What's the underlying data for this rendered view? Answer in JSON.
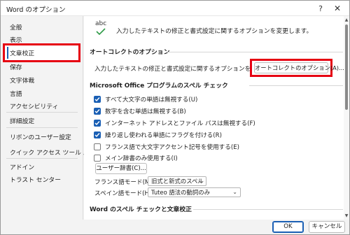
{
  "window": {
    "title": "Word のオプション",
    "help_glyph": "?",
    "close_glyph": "✕"
  },
  "sidebar": {
    "items": [
      {
        "label": "全般"
      },
      {
        "label": "表示"
      },
      {
        "label": "文章校正",
        "selected": true
      },
      {
        "label": "保存"
      },
      {
        "label": "文字体裁"
      },
      {
        "label": "言語"
      },
      {
        "label": "アクセシビリティ"
      },
      {
        "label": "詳細設定"
      },
      {
        "label": "リボンのユーザー設定"
      },
      {
        "label": "クイック アクセス ツール バー"
      },
      {
        "label": "アドイン"
      },
      {
        "label": "トラスト センター"
      }
    ]
  },
  "main": {
    "icon_text": "abc",
    "intro": "入力したテキストの修正と書式設定に関するオプションを変更します。",
    "autocorrect_section": {
      "title": "オートコレクトのオプション",
      "description": "入力したテキストの修正と書式設定に関するオプションを変更します。",
      "button_label": "オートコレクトのオプション(A)..."
    },
    "spell_section": {
      "title": "Microsoft Office プログラムのスペル チェック",
      "options": [
        {
          "label": "すべて大文字の単語は無視する(U)",
          "checked": true
        },
        {
          "label": "数字を含む単語は無視する(B)",
          "checked": true
        },
        {
          "label": "インターネット アドレスとファイル パスは無視する(F)",
          "checked": true
        },
        {
          "label": "繰り返し使われる単語にフラグを付ける(R)",
          "checked": true
        },
        {
          "label": "フランス語で大文字アクセント記号を使用する(E)",
          "checked": false
        },
        {
          "label": "メイン辞書のみ使用する(I)",
          "checked": false
        }
      ],
      "custom_dict_button": "ユーザー辞書(C)...",
      "french_mode_label": "フランス語モード(M):",
      "french_mode_value": "旧式と新式のスペル",
      "spanish_mode_label": "スペイン語モード(H):",
      "spanish_mode_value": "Tuteo 語法の動詞のみ"
    },
    "word_section": {
      "title": "Word のスペル チェックと文章校正"
    }
  },
  "footer": {
    "ok_label": "OK",
    "cancel_label": "キャンセル"
  },
  "colors": {
    "accent": "#1a5fb4",
    "highlight_border": "#e60012"
  }
}
